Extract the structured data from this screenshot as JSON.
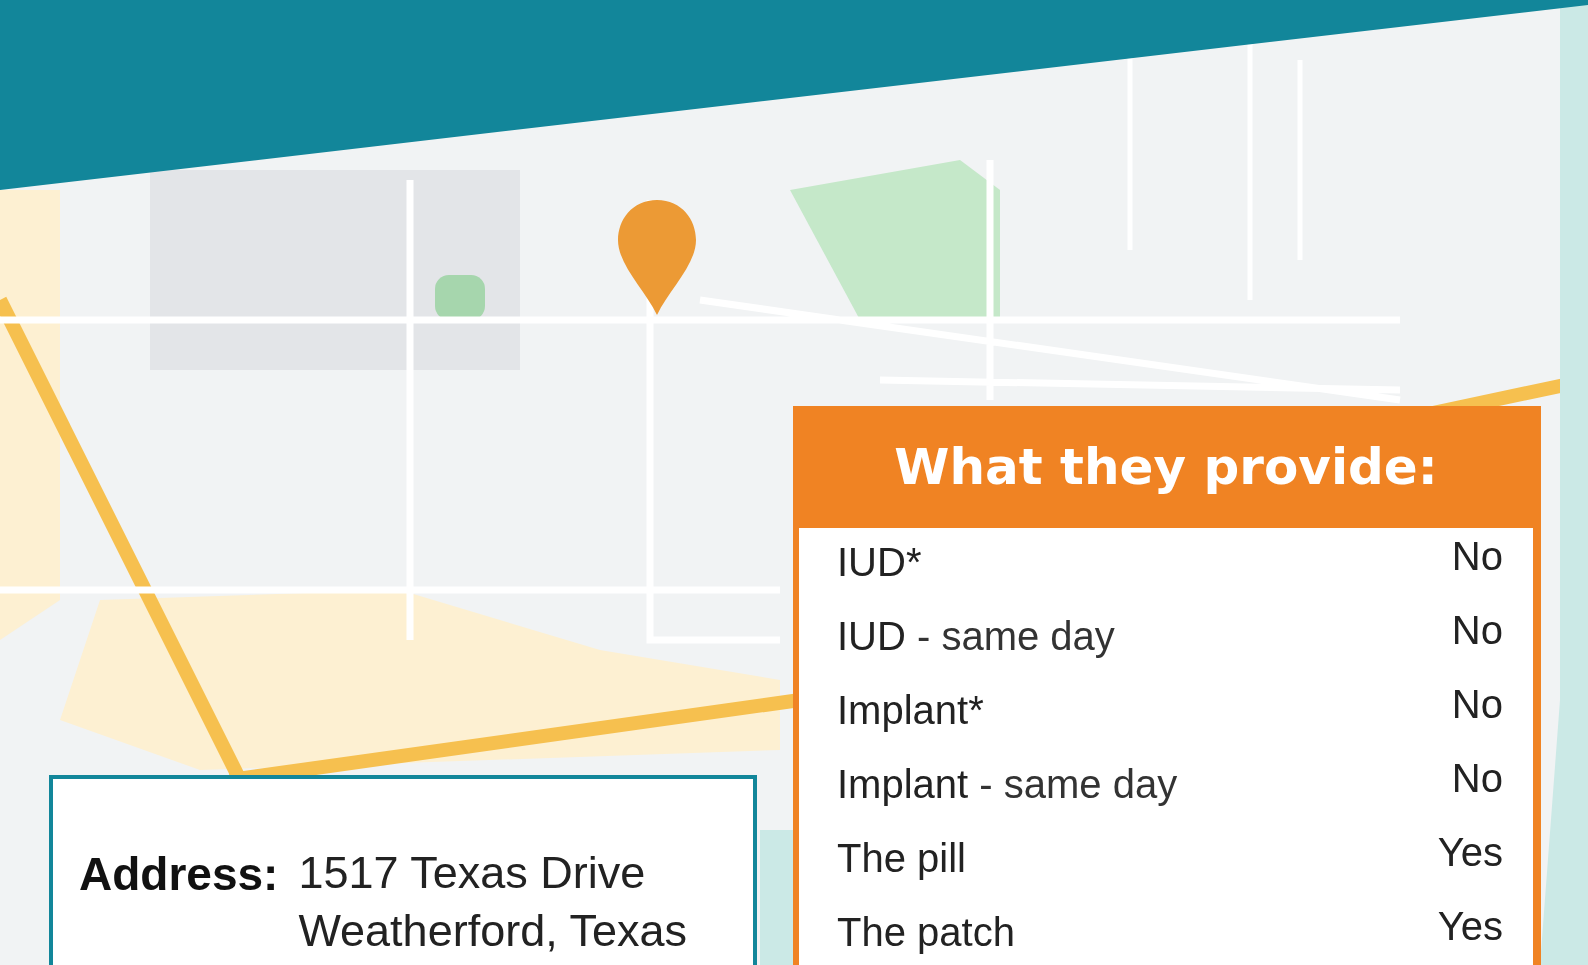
{
  "provider_card": {
    "title": "What they provide:",
    "rows": [
      {
        "name": "IUD*",
        "detail": "",
        "value": "No"
      },
      {
        "name": "IUD",
        "detail": "- same day",
        "value": "No"
      },
      {
        "name": "Implant*",
        "detail": "",
        "value": "No"
      },
      {
        "name": "Implant",
        "detail": "- same day",
        "value": "No"
      },
      {
        "name": "The pill",
        "detail": "",
        "value": "Yes"
      },
      {
        "name": "The patch",
        "detail": "",
        "value": "Yes"
      }
    ]
  },
  "address_card": {
    "label": "Address:",
    "lines": [
      "1517 Texas Drive",
      "Weatherford, Texas"
    ]
  }
}
